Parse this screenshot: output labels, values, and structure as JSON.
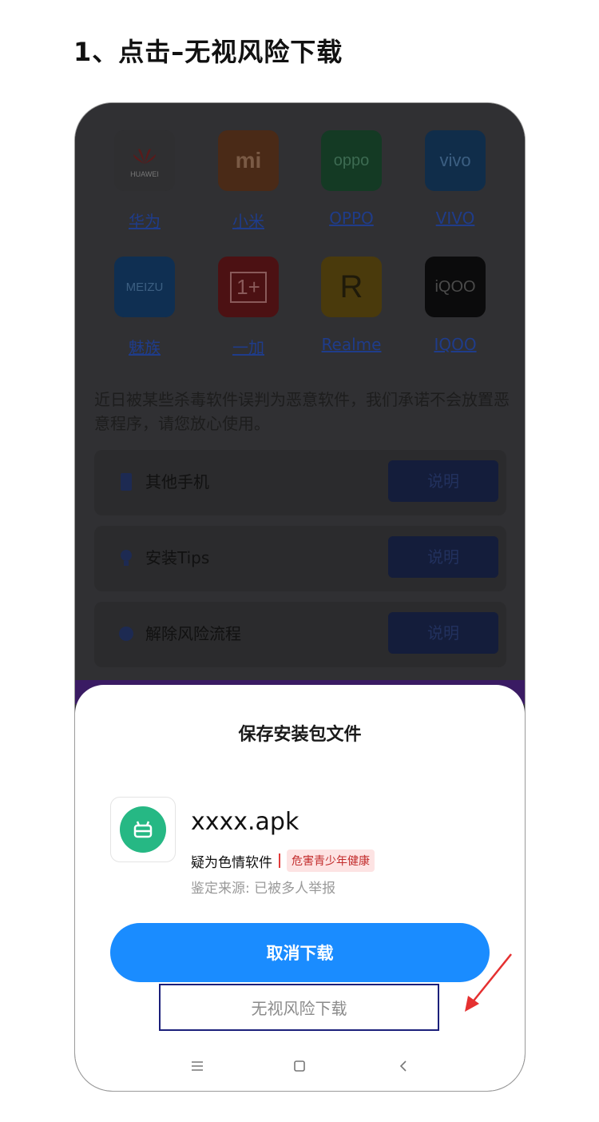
{
  "page": {
    "title": "1、点击–无视风险下载"
  },
  "brands": [
    {
      "name": "华为",
      "logo_text": "HUAWEI",
      "color": "#2f2f31"
    },
    {
      "name": "小米",
      "logo_text": "mi",
      "color": "#4a2a17"
    },
    {
      "name": "OPPO",
      "logo_text": "oppo",
      "color": "#143a24"
    },
    {
      "name": "VIVO",
      "logo_text": "vivo",
      "color": "#102d4a"
    },
    {
      "name": "魅族",
      "logo_text": "MEIZU",
      "color": "#0f2f52"
    },
    {
      "name": "一加",
      "logo_text": "1+",
      "color": "#4c1113"
    },
    {
      "name": "Realme",
      "logo_text": "R",
      "color": "#4a3a0c"
    },
    {
      "name": "IQOO",
      "logo_text": "iQOO",
      "color": "#0b0b0c"
    }
  ],
  "notice": "近日被某些杀毒软件误判为恶意软件，我们承诺不会放置恶意程序，请您放心使用。",
  "rows": [
    {
      "label": "其他手机",
      "icon": "phone-icon",
      "button": "说明"
    },
    {
      "label": "安装Tips",
      "icon": "bulb-icon",
      "button": "说明"
    },
    {
      "label": "解除风险流程",
      "icon": "shield-icon",
      "button": "说明"
    }
  ],
  "dialog": {
    "title": "保存安装包文件",
    "apk_name": "xxxx.apk",
    "warning": "疑为色情软件",
    "badge": "危害青少年健康",
    "source": "鉴定来源: 已被多人举报",
    "cancel_label": "取消下载",
    "ignore_label": "无视风险下载"
  },
  "colors": {
    "accent": "#1a8cff",
    "warning": "#c22b2b",
    "highlight_box": "#1b1f7a",
    "arrow": "#e53030"
  }
}
